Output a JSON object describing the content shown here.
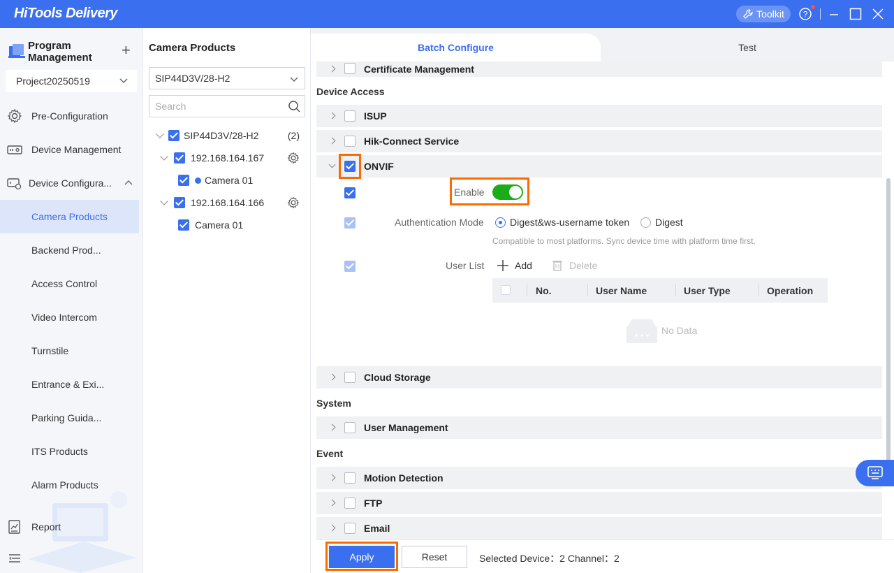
{
  "app": {
    "title": "HiTools Delivery",
    "toolkit_label": "Toolkit",
    "colors": {
      "accent": "#3a6ff0",
      "highlight": "#ff6a00",
      "toggle_on": "#1aad19"
    }
  },
  "sidebar": {
    "program_title_line1": "Program",
    "program_title_line2": "Management",
    "project": "Project20250519",
    "items": [
      {
        "label": "Pre-Configuration",
        "icon": "gear-icon"
      },
      {
        "label": "Device Management",
        "icon": "device-icon"
      },
      {
        "label": "Device Configura...",
        "icon": "device-config-icon"
      },
      {
        "label": "Camera Products"
      },
      {
        "label": "Backend Prod..."
      },
      {
        "label": "Access Control"
      },
      {
        "label": "Video Intercom"
      },
      {
        "label": "Turnstile"
      },
      {
        "label": "Entrance & Exi..."
      },
      {
        "label": "Parking Guida..."
      },
      {
        "label": "ITS Products"
      },
      {
        "label": "Alarm Products"
      },
      {
        "label": "Report",
        "icon": "report-icon"
      }
    ]
  },
  "tree": {
    "title": "Camera Products",
    "model_select": "SIP44D3V/28-H2",
    "search_placeholder": "Search",
    "root_label": "SIP44D3V/28-H2",
    "root_count": "(2)",
    "devices": [
      {
        "ip": "192.168.164.167",
        "camera": "Camera 01"
      },
      {
        "ip": "192.168.164.166",
        "camera": "Camera 01"
      }
    ]
  },
  "main": {
    "tabs": [
      "Batch Configure",
      "Test"
    ],
    "groups": {
      "certificate": "Certificate Management",
      "device_access_section": "Device Access",
      "isup": "ISUP",
      "hik_connect": "Hik-Connect Service",
      "onvif": "ONVIF",
      "cloud_storage": "Cloud Storage",
      "system_section": "System",
      "user_management": "User Management",
      "event_section": "Event",
      "motion_detection": "Motion Detection",
      "ftp": "FTP",
      "email": "Email"
    },
    "onvif": {
      "enable_label": "Enable",
      "enabled": true,
      "auth_label": "Authentication Mode",
      "auth_options": [
        "Digest&ws-username token",
        "Digest"
      ],
      "auth_hint": "Compatible to most platforms. Sync device time with platform time first.",
      "user_list_label": "User List",
      "add_label": "Add",
      "delete_label": "Delete",
      "columns": [
        "No.",
        "User Name",
        "User Type",
        "Operation"
      ],
      "empty_text": "No Data"
    },
    "footer": {
      "apply": "Apply",
      "reset": "Reset",
      "selected_info": "Selected Device：2 Channel：2"
    }
  }
}
